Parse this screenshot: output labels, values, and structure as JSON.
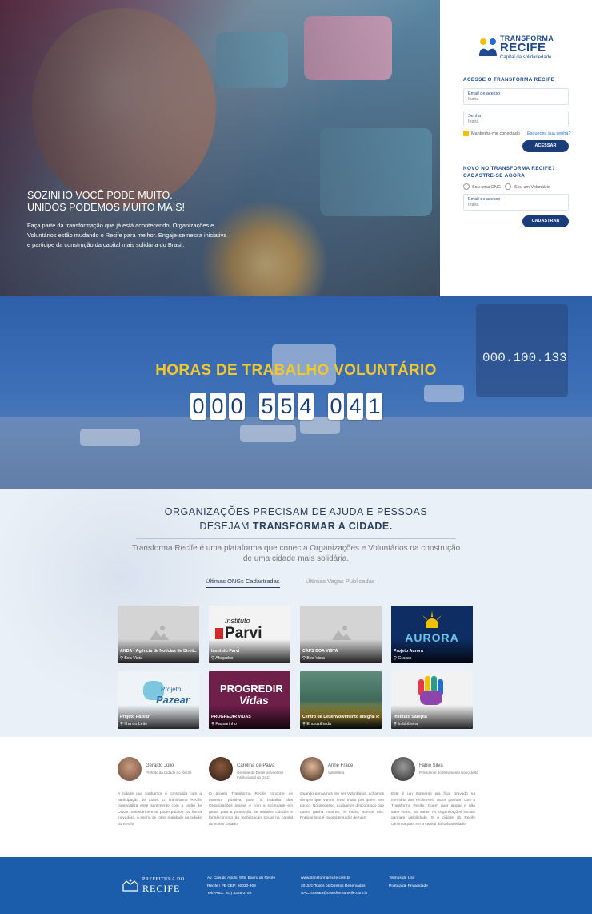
{
  "hero": {
    "headline_1": "SOZINHO VOCÊ PODE MUITO.",
    "headline_2": "UNIDOS PODEMOS MUITO MAIS!",
    "text": "Faça parte da transformação que já está acontecendo. Organizações e Voluntários estão mudando o Recife para melhor. Engaje-se nessa iniciativa e participe da construção da capital mais solidária do Brasil."
  },
  "logo": {
    "line1": "TRANSFORMA",
    "line2": "RECIFE",
    "line3": "Capital da solidariedade"
  },
  "login": {
    "title": "ACESSE O TRANSFORMA RECIFE",
    "email_label": "Email de acesso",
    "email_placeholder": "Insira",
    "password_label": "Senha",
    "password_placeholder": "Insira",
    "remember": "Mantenha-me conectado",
    "forgot": "Esqueceu sua senha?",
    "submit": "ACESSAR"
  },
  "register": {
    "title_1": "NOVO NO TRANSFORMA RECIFE?",
    "title_2": "CADASTRE-SE AGORA",
    "option_ong": "Sou uma ONG",
    "option_vol": "Sou um Voluntário",
    "email_label": "Email de acesso",
    "email_placeholder": "Insira",
    "submit": "CADASTRAR"
  },
  "counter": {
    "title": "HORAS DE TRABALHO VOLUNTÁRIO",
    "digits": [
      "0",
      "0",
      "0",
      "5",
      "5",
      "4",
      "0",
      "4",
      "1"
    ],
    "sign_value": "000.100.133"
  },
  "orgs": {
    "title_1": "ORGANIZAÇÕES PRECISAM DE AJUDA E PESSOAS",
    "title_2a": "DESEJAM ",
    "title_2b": "TRANSFORMAR A CIDADE.",
    "desc": "Transforma Recife é uma plataforma que conecta Organizações e Voluntários na construção de uma cidade mais solidária.",
    "tab_active": "Últimas ONGs Cadastradas",
    "tab_inactive": "Últimas Vagas Publicadas",
    "cards": [
      {
        "name": "ANDA - Agência de Notícias de Direit...",
        "location": "Boa Vista",
        "bg": "#d4d4d4"
      },
      {
        "name": "Instituto Parvi",
        "location": "Afogados",
        "bg": "#f3f3f3",
        "logo_a": "Instituto",
        "logo_b": "Parvi"
      },
      {
        "name": "CAPS BOA VISTA",
        "location": "Boa Vista",
        "bg": "#d4d4d4"
      },
      {
        "name": "Projeto Aurora",
        "location": "Graças",
        "bg": "#0e2d63",
        "logo_a": "AURORA"
      },
      {
        "name": "Projeto Pazear",
        "location": "Ilha do Leite",
        "bg": "#eef3f8",
        "logo_a": "Projeto",
        "logo_b": "Pazear"
      },
      {
        "name": "PROGREDIR VIDAS",
        "location": "Passarinho",
        "bg": "#6e1f4a",
        "logo_a": "PROGREDIR",
        "logo_b": "Vidas"
      },
      {
        "name": "Centro de Desenvolvimento Integral R...",
        "location": "Encruzilhada",
        "bg": "#3d6a5a"
      },
      {
        "name": "Instituto Sarepta",
        "location": "Imbiribeira",
        "bg": "#f2f2f2"
      }
    ]
  },
  "testimonials": [
    {
      "name": "Geraldo Júlio",
      "role": "Prefeito da Cidade do Recife",
      "text": "A cidade que sonhamos é construída com a participação de todos. O Transforma Recife potencializa esse sentimento com a união de ONGs, Voluntários e do poder público. De forma inovadora, o sonho se torna realidade na cidade do Recife."
    },
    {
      "name": "Carolina de Paiva",
      "role": "Gerente de Desenvolvimento Institucional do GAC",
      "text": "O projeto Transforma Recife concorre de maneira positiva para o trabalho das Organizações sociais e com a sociedade em geral, para a promoção de atitudes cidadãs e fortalecimento da mobilização social na capital do nosso Estado."
    },
    {
      "name": "Anne Frade",
      "role": "Voluntária",
      "text": "Quando pensamos em ser Voluntários, achamos sempre que vamos levar muito pra quem tem pouco. No processo, acabamos descobrindo que quem ganha mesmo, é muito, somos nós. Praticar isso é recompensador demais!"
    },
    {
      "name": "Fábio Silva",
      "role": "Presidente do Movimento Novo Jeito",
      "text": "Este é um momento pra ficar gravado na memória dos recifenses. Todos ganham com o Transforma Recife. Quem quer ajudar e não sabe como, vai saber. As Organizações sociais ganham visibilidade. E a cidade do Recife caminha para ser a capital da solidariedade."
    }
  ],
  "footer": {
    "pref_1": "PREFEITURA DO",
    "pref_2": "RECIFE",
    "address_1": "Av. Cais do Apolo, 925, Bairro do Recife",
    "address_2": "Recife / PE CEP: 50030-903",
    "address_3": "Tel/PABX: (81) 3355-3759",
    "site": "www.transformarecife.com.br",
    "rights": "2015 © Todos os Direitos Reservados",
    "sac_label": "SAC: ",
    "sac_email": "contato@transformarecife.com.br",
    "terms": "Termos de Uso",
    "privacy": "Política de Privacidade"
  }
}
